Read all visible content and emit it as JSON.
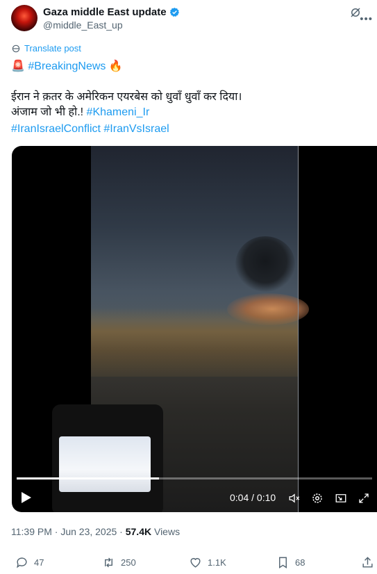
{
  "author": {
    "name": "Gaza middle East update",
    "handle": "@middle_East_up"
  },
  "translate_label": "Translate post",
  "lines": {
    "l1_emoji_start": "🚨",
    "l1_tag": "#BreakingNews",
    "l1_emoji_end": "🔥",
    "l2": "ईरान ने क़तर के अमेरिकन एयरबेस को धुवाँ धुवाँ कर दिया।",
    "l3_text": "अंजाम जो भी हो.!",
    "l3_tag": "#Khameni_Ir",
    "l4_tag1": "#IranIsraelConflict",
    "l4_tag2": "#IranVsIsrael"
  },
  "video": {
    "time": "0:04 / 0:10",
    "progress": 0.4
  },
  "meta": {
    "time": "11:39 PM · Jun 23, 2025 · ",
    "views_count": "57.4K",
    "views_label": " Views"
  },
  "actions": {
    "replies": "47",
    "reposts": "250",
    "likes": "1.1K",
    "bookmarks": "68"
  },
  "icons": [
    "verified-badge-icon",
    "grok-icon",
    "more-icon",
    "translate-icon",
    "play-icon",
    "mute-icon",
    "settings-icon",
    "pip-icon",
    "fullscreen-icon",
    "reply-icon",
    "repost-icon",
    "like-icon",
    "bookmark-icon",
    "share-icon"
  ],
  "colors": {
    "accent": "#1d9bf0",
    "text": "#0f1419",
    "muted": "#536471"
  }
}
